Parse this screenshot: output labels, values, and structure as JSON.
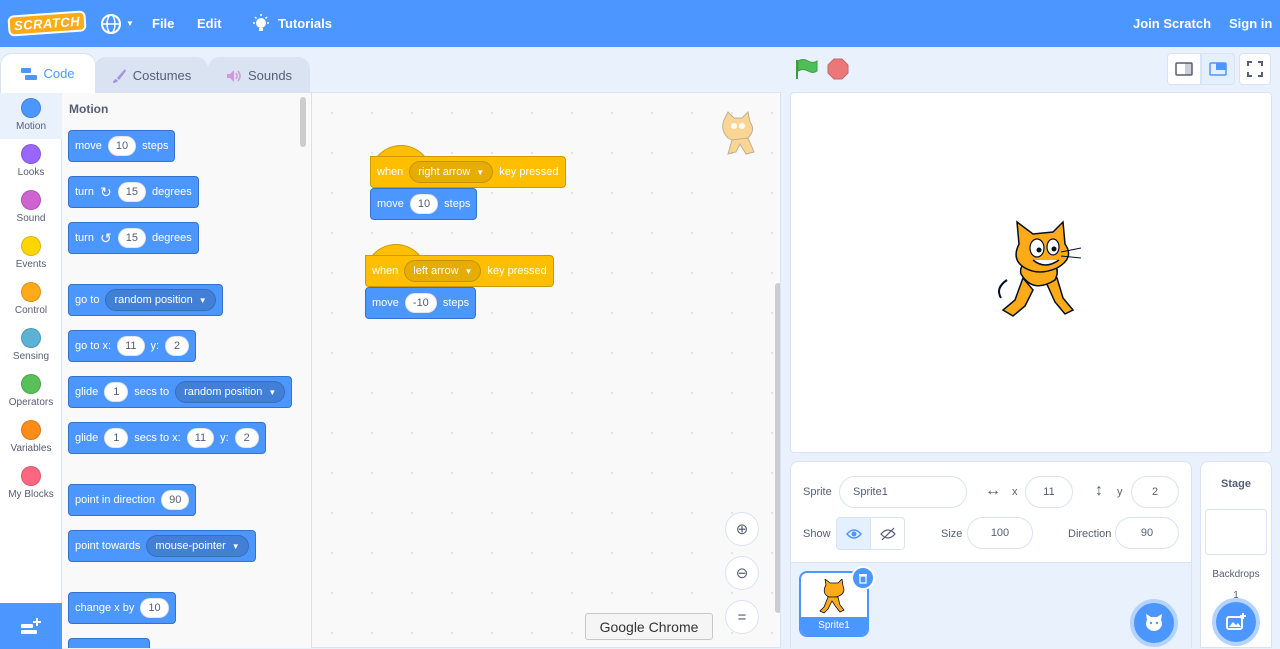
{
  "menubar": {
    "logo": "SCRATCH",
    "file": "File",
    "edit": "Edit",
    "tutorials": "Tutorials",
    "join": "Join Scratch",
    "signin": "Sign in"
  },
  "tabs": {
    "code": "Code",
    "costumes": "Costumes",
    "sounds": "Sounds"
  },
  "categories": [
    {
      "label": "Motion",
      "color": "#4c97ff"
    },
    {
      "label": "Looks",
      "color": "#9966ff"
    },
    {
      "label": "Sound",
      "color": "#cf63cf"
    },
    {
      "label": "Events",
      "color": "#ffd500"
    },
    {
      "label": "Control",
      "color": "#ffab19"
    },
    {
      "label": "Sensing",
      "color": "#5cb1d6"
    },
    {
      "label": "Operators",
      "color": "#59c059"
    },
    {
      "label": "Variables",
      "color": "#ff8c1a"
    },
    {
      "label": "My Blocks",
      "color": "#ff6680"
    }
  ],
  "palette": {
    "heading": "Motion",
    "move": {
      "label": "move",
      "value": "10",
      "unit": "steps"
    },
    "turn_right": {
      "label": "turn",
      "value": "15",
      "unit": "degrees"
    },
    "turn_left": {
      "label": "turn",
      "value": "15",
      "unit": "degrees"
    },
    "goto": {
      "label": "go to",
      "option": "random position"
    },
    "goto_xy": {
      "label": "go to x:",
      "x": "11",
      "ylabel": "y:",
      "y": "2"
    },
    "glide": {
      "label": "glide",
      "value": "1",
      "mid": "secs to",
      "option": "random position"
    },
    "glide_xy": {
      "label": "glide",
      "value": "1",
      "mid": "secs to x:",
      "x": "11",
      "ylabel": "y:",
      "y": "2"
    },
    "point_dir": {
      "label": "point in direction",
      "value": "90"
    },
    "point_towards": {
      "label": "point towards",
      "option": "mouse-pointer"
    },
    "change_x": {
      "label": "change x by",
      "value": "10"
    }
  },
  "scripts": [
    {
      "when": "when",
      "key": "right arrow",
      "pressed": "key pressed",
      "move": "move",
      "value": "10",
      "unit": "steps"
    },
    {
      "when": "when",
      "key": "left arrow",
      "pressed": "key pressed",
      "move": "move",
      "value": "-10",
      "unit": "steps"
    }
  ],
  "tooltip": "Google Chrome",
  "sprite": {
    "label": "Sprite",
    "name": "Sprite1",
    "x_label": "x",
    "x": "11",
    "y_label": "y",
    "y": "2",
    "show_label": "Show",
    "size_label": "Size",
    "size": "100",
    "direction_label": "Direction",
    "direction": "90",
    "thumb_name": "Sprite1"
  },
  "stage_panel": {
    "title": "Stage",
    "backdrops_label": "Backdrops",
    "backdrops_count": "1"
  },
  "colors": {
    "motion": "#4c97ff",
    "events": "#ffbf00",
    "menubar": "#4c97ff"
  }
}
